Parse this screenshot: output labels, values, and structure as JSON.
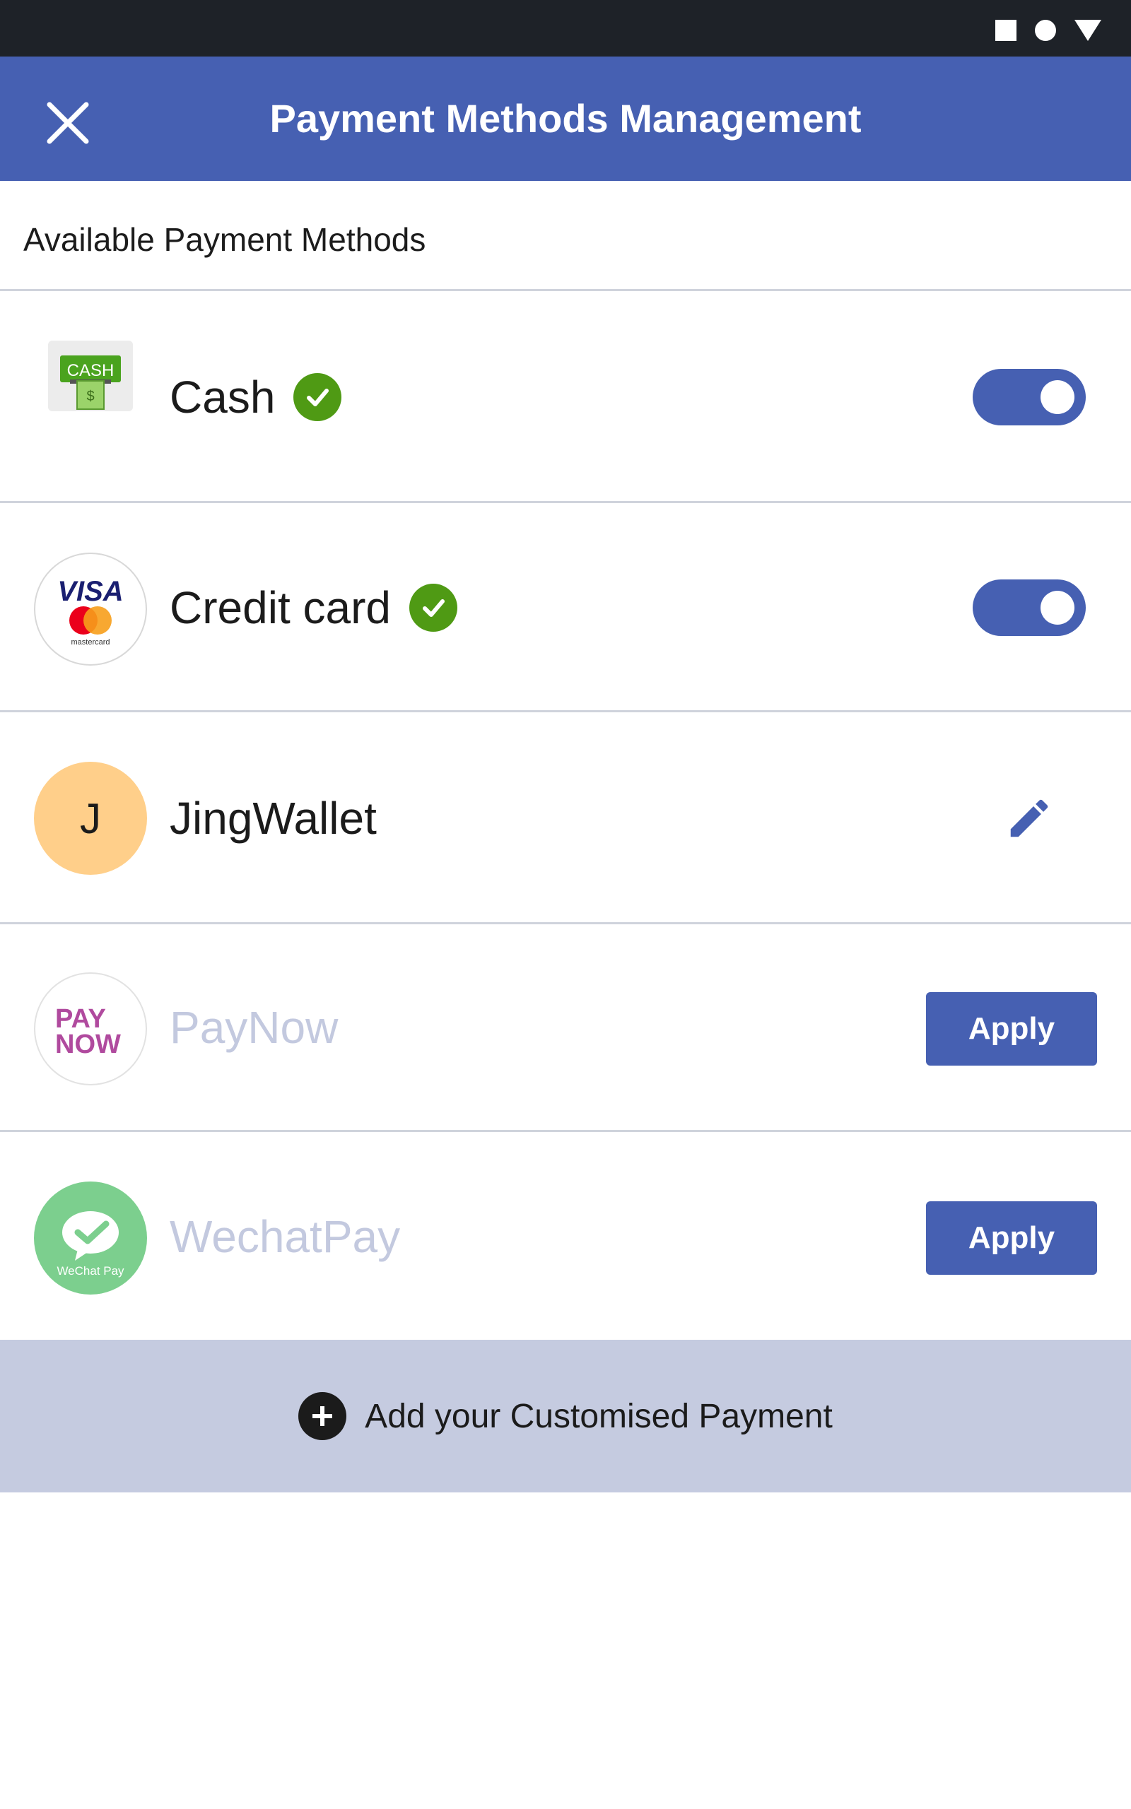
{
  "header": {
    "title": "Payment Methods Management",
    "close_icon": "close-icon"
  },
  "section": {
    "title": "Available Payment Methods"
  },
  "methods": [
    {
      "name": "Cash",
      "icon": "cash-icon",
      "icon_text": "CASH",
      "verified": true,
      "control": "toggle",
      "enabled": true
    },
    {
      "name": "Credit card",
      "icon": "visa-mastercard-icon",
      "icon_text": "VISA",
      "icon_subtext": "mastercard",
      "verified": true,
      "control": "toggle",
      "enabled": true
    },
    {
      "name": "JingWallet",
      "icon": "avatar-letter",
      "icon_text": "J",
      "verified": false,
      "control": "edit"
    },
    {
      "name": "PayNow",
      "icon": "paynow-icon",
      "icon_text": "PAY",
      "icon_text2": "NOW",
      "control": "button",
      "button_label": "Apply",
      "disabled_label": true
    },
    {
      "name": "WechatPay",
      "icon": "wechat-pay-icon",
      "icon_text": "WeChat Pay",
      "control": "button",
      "button_label": "Apply",
      "disabled_label": true
    }
  ],
  "footer": {
    "add_label": "Add your Customised Payment"
  },
  "colors": {
    "primary": "#4660b2",
    "verified": "#4f9a14",
    "status_bar": "#1e2228",
    "add_bar": "#c5cbe0",
    "disabled_text": "#c3c9df",
    "avatar_bg": "#ffcf8a"
  }
}
